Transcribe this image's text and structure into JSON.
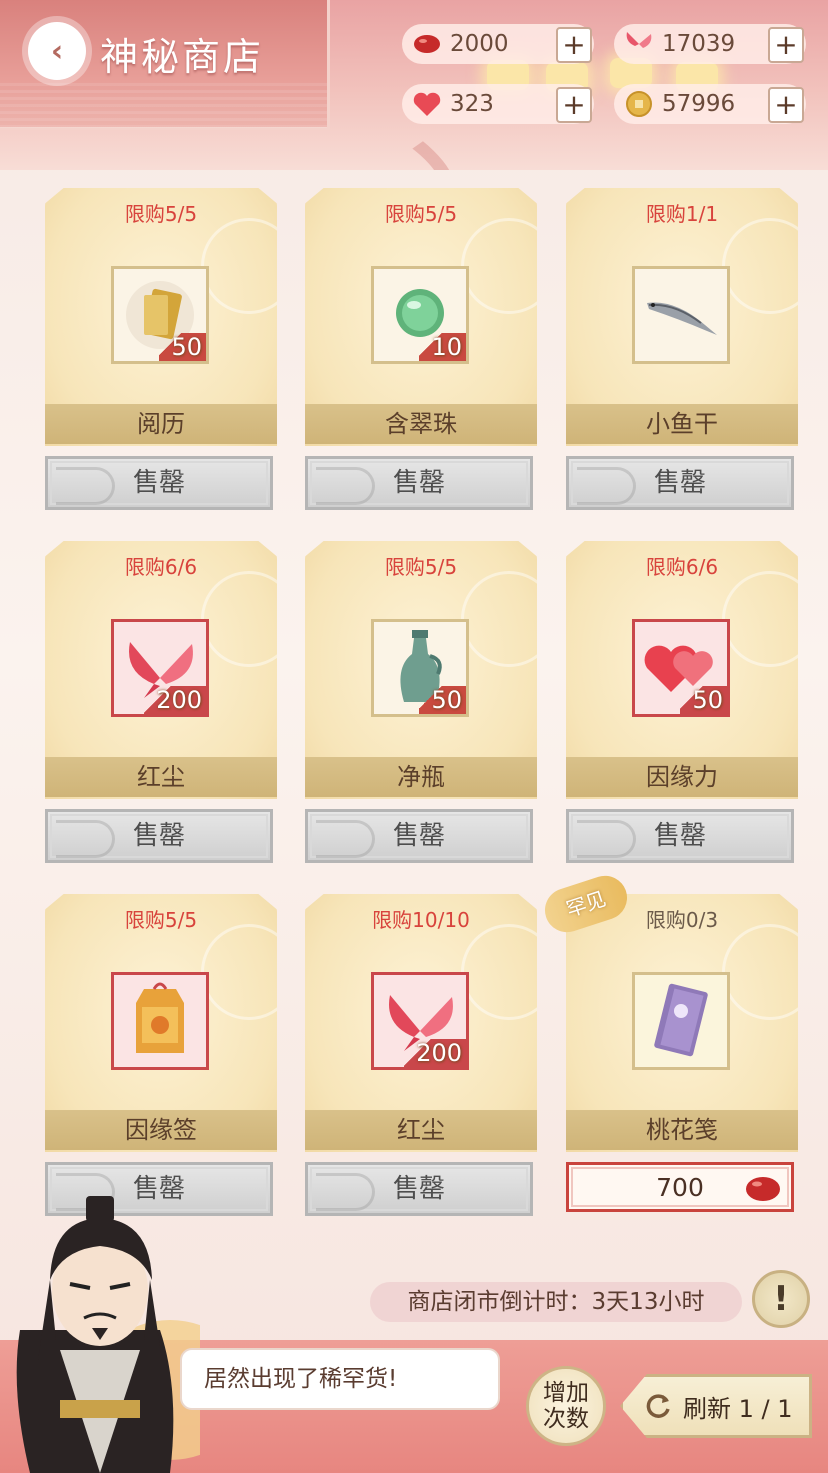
{
  "header": {
    "title": "神秘商店",
    "back_icon": "back-arrow-icon"
  },
  "currencies": [
    {
      "name": "red-bean",
      "icon": "red-bean-icon",
      "value": "2000",
      "color": "#c62a2a"
    },
    {
      "name": "butterfly",
      "icon": "butterfly-icon",
      "value": "17039",
      "color": "#e8566a"
    },
    {
      "name": "heart",
      "icon": "heart-icon",
      "value": "323",
      "color": "#e84a55"
    },
    {
      "name": "coin",
      "icon": "coin-icon",
      "value": "57996",
      "color": "#e5b64a"
    }
  ],
  "plus_label": "+",
  "items": [
    {
      "limit": "限购5/5",
      "qty": "50",
      "name": "阅历",
      "button": "售罄",
      "icon": "book-scroll-icon",
      "frame": "gold"
    },
    {
      "limit": "限购5/5",
      "qty": "10",
      "name": "含翠珠",
      "button": "售罄",
      "icon": "jade-orb-icon",
      "frame": "gold"
    },
    {
      "limit": "限购1/1",
      "qty": "",
      "name": "小鱼干",
      "button": "售罄",
      "icon": "dried-fish-icon",
      "frame": "gold"
    },
    {
      "limit": "限购6/6",
      "qty": "200",
      "name": "红尘",
      "button": "售罄",
      "icon": "butterfly-icon",
      "frame": "pink"
    },
    {
      "limit": "限购5/5",
      "qty": "50",
      "name": "净瓶",
      "button": "售罄",
      "icon": "vase-icon",
      "frame": "gold"
    },
    {
      "limit": "限购6/6",
      "qty": "50",
      "name": "因缘力",
      "button": "售罄",
      "icon": "hearts-icon",
      "frame": "pink"
    },
    {
      "limit": "限购5/5",
      "qty": "",
      "name": "因缘签",
      "button": "售罄",
      "icon": "amulet-icon",
      "frame": "pink"
    },
    {
      "limit": "限购10/10",
      "qty": "200",
      "name": "红尘",
      "button": "售罄",
      "icon": "butterfly-icon",
      "frame": "pink"
    },
    {
      "limit": "限购0/3",
      "qty": "",
      "name": "桃花笺",
      "button": "700",
      "icon": "letter-paper-icon",
      "frame": "gold",
      "rare": "罕见",
      "price_icon": "red-bean-icon"
    }
  ],
  "footer": {
    "countdown": "商店闭市倒计时：3天13小时",
    "info": "!",
    "speech": "居然出现了稀罕货!",
    "add_line1": "增加",
    "add_line2": "次数",
    "refresh": "刷新 1 / 1"
  }
}
